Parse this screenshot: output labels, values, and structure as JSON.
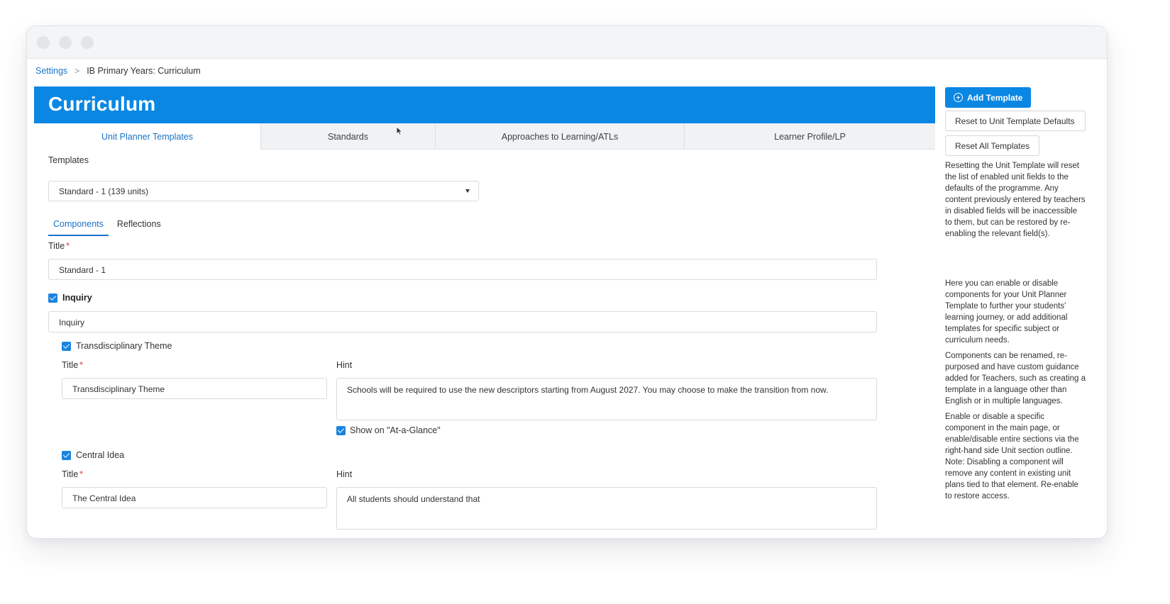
{
  "breadcrumb": {
    "root": "Settings",
    "separator": ">",
    "current": "IB Primary Years: Curriculum"
  },
  "header": {
    "title": "Curriculum"
  },
  "tabs": [
    {
      "label": "Unit Planner Templates",
      "active": true
    },
    {
      "label": "Standards",
      "active": false
    },
    {
      "label": "Approaches to Learning/ATLs",
      "active": false
    },
    {
      "label": "Learner Profile/LP",
      "active": false
    }
  ],
  "templates": {
    "label": "Templates",
    "selected": "Standard - 1 (139 units)"
  },
  "subtabs": {
    "components": "Components",
    "reflections": "Reflections"
  },
  "title_field": {
    "label": "Title",
    "required_mark": "*",
    "value": "Standard - 1"
  },
  "inquiry": {
    "label": "Inquiry",
    "value": "Inquiry"
  },
  "transdisciplinary": {
    "label": "Transdisciplinary Theme",
    "title_label": "Title",
    "title_value": "Transdisciplinary Theme",
    "hint_label": "Hint",
    "hint_value": "Schools will be required to use the new descriptors starting from August 2027. You may choose to make the transition from now.",
    "glance_label": "Show on \"At-a-Glance\""
  },
  "central_idea": {
    "label": "Central Idea",
    "title_label": "Title",
    "title_value": "The Central Idea",
    "hint_label": "Hint",
    "hint_value": "All students should understand that"
  },
  "sidebar": {
    "add_template": "Add Template",
    "reset_unit": "Reset to Unit Template Defaults",
    "reset_all": "Reset All Templates",
    "reset_note": "Resetting the Unit Template will reset the list of enabled unit fields to the defaults of the programme. Any content previously entered by teachers in disabled fields will be inaccessible to them, but can be restored by re-enabling the relevant field(s).",
    "help_1": "Here you can enable or disable components for your Unit Planner Template to further your students' learning journey, or add additional templates for specific subject or curriculum needs.",
    "help_2": "Components can be renamed, re-purposed and have custom guidance added for Teachers, such as creating a template in a language other than English or in multiple languages.",
    "help_3": "Enable or disable a specific component in the main page, or enable/disable entire sections via the right-hand side Unit section outline. Note: Disabling a component will remove any content in existing unit plans tied to that element. Re-enable to restore access."
  },
  "colors": {
    "brand": "#0a87e3",
    "link": "#1a73c9",
    "required": "#e23b3b"
  }
}
